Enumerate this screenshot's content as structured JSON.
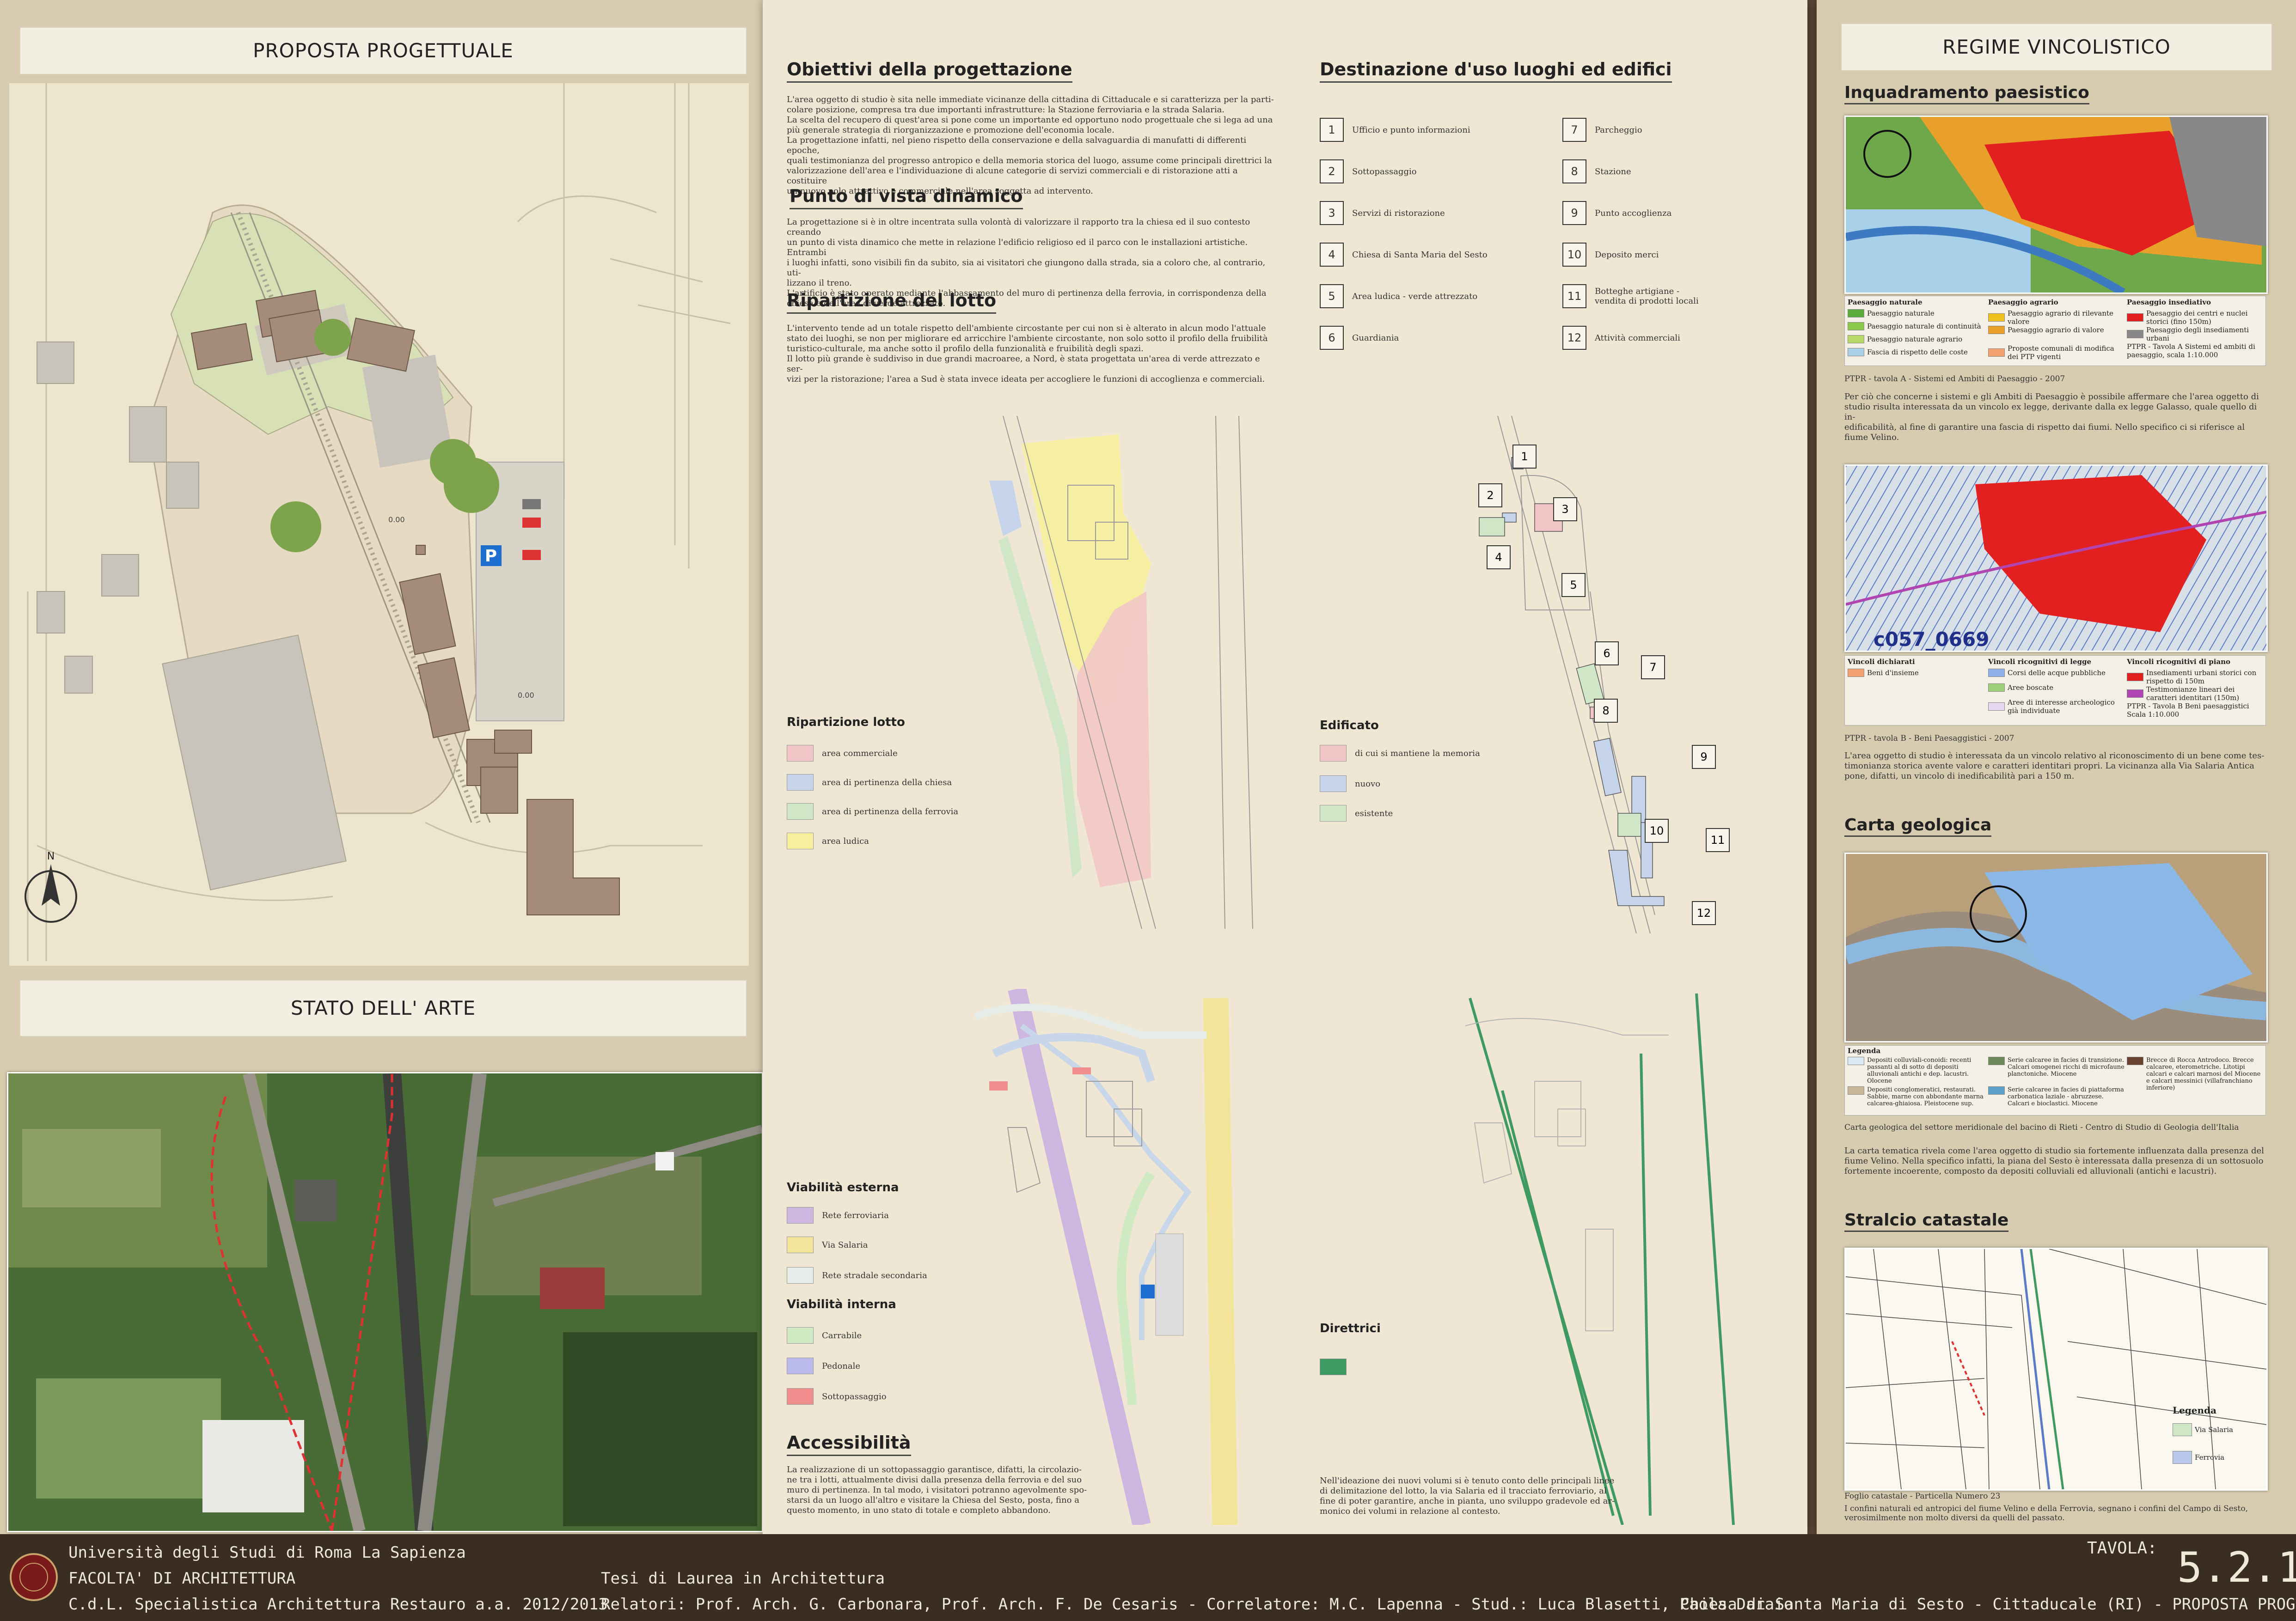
{
  "left": {
    "proposal_title": "PROPOSTA PROGETTUALE",
    "state_title": "STATO DELL' ARTE",
    "parking_icon": "P",
    "north": "N",
    "elev_a": "0.00",
    "elev_b": "0.00"
  },
  "mid": {
    "obj_heading": "Obiettivi della progettazione",
    "obj_text": "L'area oggetto di studio è sita nelle immediate vicinanze della cittadina di Cittaducale e si caratterizza per la parti-\ncolare posizione, compresa tra due importanti infrastrutture: la Stazione ferroviaria e la strada Salaria.\nLa scelta del recupero di quest'area si pone come un importante ed opportuno nodo progettuale che si lega ad una\npiù generale strategia di riorganizzazione e promozione dell'economia locale.\nLa progettazione infatti, nel pieno rispetto della conservazione e della salvaguardia di manufatti di differenti epoche,\nquali testimonianza del progresso antropico e della memoria storica del luogo, assume come principali direttrici la\nvalorizzazione dell'area e l'individuazione di alcune categorie di servizi commerciali e di ristorazione atti a costituire\nun nuovo polo attrattivo e commerciale nell'area soggetta ad intervento.",
    "view_heading": "Punto di vista dinamico",
    "view_text": "La progettazione si è in oltre incentrata sulla volontà di valorizzare il rapporto tra la chiesa ed il suo contesto creando\nun punto di vista dinamico che mette in relazione l'edificio religioso ed il parco con le installazioni artistiche. Entrambi\ni luoghi infatti, sono visibili fin da subito, sia ai visitatori che giungono dalla strada, sia a coloro che, al contrario, uti-\nlizzano il treno.\nL'artificio è stato operato mediante l'abbassamento del muro di pertinenza della ferrovia, in corrispondenza della\nchiesa e dell'area di verde attrezzato.",
    "lot_heading": "Ripartizione del lotto",
    "lot_text": "L'intervento tende ad un totale rispetto dell'ambiente circostante per cui non si è alterato in alcun modo l'attuale\nstato dei luoghi, se non per migliorare ed arricchire l'ambiente circostante, non solo sotto il profilo della fruibilità\nturistico-culturale, ma anche sotto il profilo della funzionalità e fruibilità degli spazi.\nIl lotto più grande è suddiviso in due grandi macroaree, a Nord, è stata progettata un'area di verde attrezzato e ser-\nvizi per la ristorazione; l'area a Sud è stata invece ideata per accogliere le funzioni di accoglienza e commerciali.",
    "dest_heading": "Destinazione d'uso luoghi ed edifici",
    "dest_items": [
      {
        "n": "1",
        "label": "Ufficio e punto informazioni"
      },
      {
        "n": "2",
        "label": "Sottopassaggio"
      },
      {
        "n": "3",
        "label": "Servizi di ristorazione"
      },
      {
        "n": "4",
        "label": "Chiesa di Santa Maria del Sesto"
      },
      {
        "n": "5",
        "label": "Area ludica - verde attrezzato"
      },
      {
        "n": "6",
        "label": "Guardiania"
      },
      {
        "n": "7",
        "label": "Parcheggio"
      },
      {
        "n": "8",
        "label": "Stazione"
      },
      {
        "n": "9",
        "label": "Punto accoglienza"
      },
      {
        "n": "10",
        "label": "Deposito merci"
      },
      {
        "n": "11",
        "label": "Botteghe artigiane - vendita di prodotti locali"
      },
      {
        "n": "12",
        "label": "Attività commerciali"
      }
    ],
    "rip_title": "Ripartizione lotto",
    "rip_items": [
      "area commerciale",
      "area di pertinenza della chiesa",
      "area di pertinenza della ferrovia",
      "area ludica"
    ],
    "edif_title": "Edificato",
    "edif_items": [
      "di cui si mantiene la memoria",
      "nuovo",
      "esistente"
    ],
    "viab_ext_title": "Viabilità esterna",
    "viab_ext_items": [
      "Rete ferroviaria",
      "Via Salaria",
      "Rete stradale secondaria"
    ],
    "viab_int_title": "Viabilità interna",
    "viab_int_items": [
      "Carrabile",
      "Pedonale",
      "Sottopassaggio"
    ],
    "dir_title": "Direttrici",
    "access_heading": "Accessibilità",
    "access_text": "La realizzazione di un sottopassaggio garantisce, difatti, la circolazio-\nne tra i lotti, attualmente divisi dalla presenza della ferrovia e del suo\nmuro di pertinenza. In tal modo, i visitatori potranno agevolmente spo-\nstarsi da un luogo all'altro e visitare la Chiesa del Sesto, posta, fino a\nquesto momento, in uno stato di totale e completo abbandono.",
    "dir_text": "Nell'ideazione dei nuovi volumi si è tenuto conto delle principali linee\ndi delimitazione del lotto, la via Salaria ed il tracciato ferroviario, al\nfine di poter garantire, anche in pianta, uno sviluppo gradevole ed ar-\nmonico dei volumi in relazione al contesto."
  },
  "right": {
    "title": "REGIME VINCOLISTICO",
    "paes_heading": "Inquadramento paesistico",
    "paes_legend": {
      "h1": "Paesaggio naturale",
      "h2": "Paesaggio agrario",
      "h3": "Paesaggio insediativo",
      "c1": [
        "Paesaggio naturale",
        "Paesaggio naturale di continuità",
        "Paesaggio naturale agrario",
        "Fascia di rispetto delle coste"
      ],
      "c2": [
        "Paesaggio agrario di rilevante valore",
        "Paesaggio agrario di valore",
        "Proposte comunali di modifica dei PTP vigenti"
      ],
      "c3": [
        "Paesaggio dei centri e nuclei storici (fino 150m)",
        "Paesaggio degli insediamenti urbani",
        "PTPR - Tavola A Sistemi ed ambiti di paesaggio, scala 1:10.000"
      ]
    },
    "paes_caption": "PTPR - tavola A - Sistemi ed Ambiti di Paesaggio - 2007",
    "paes_text": "Per ciò che concerne i sistemi e gli Ambiti di Paesaggio è possibile affermare che l'area oggetto di\nstudio risulta interessata da un vincolo ex legge, derivante dalla ex legge Galasso, quale quello di in-\nedificabilità, al fine di garantire una fascia di rispetto dai fiumi. Nello specifico ci si riferisce al\nfiume Velino.",
    "map2_code": "c057_0669",
    "vinc_legend": {
      "h1": "Vincoli dichiarati",
      "h2": "Vincoli ricognitivi di legge",
      "h3": "Vincoli ricognitivi di piano",
      "c1": [
        "Beni d'insieme"
      ],
      "c2": [
        "Corsi delle acque pubbliche",
        "Aree boscate",
        "Aree di interesse archeologico già individuate"
      ],
      "c3": [
        "Insediamenti urbani storici con rispetto di 150m",
        "Testimonianze lineari dei caratteri identitari (150m)",
        "PTPR - Tavola B Beni paesaggistici Scala 1:10.000"
      ]
    },
    "vinc_caption": "PTPR - tavola B - Beni Paesaggistici - 2007",
    "vinc_text": "L'area oggetto di studio è interessata da un vincolo relativo al riconoscimento di un bene come tes-\ntimonianza storica avente valore e caratteri identitari propri. La vicinanza alla Via Salaria Antica\npone, difatti, un vincolo di inedificabilità pari a 150 m.",
    "geo_heading": "Carta geologica",
    "geo_legend_title": "Legenda",
    "geo_legend": [
      "Depositi colluviali-conoidi: recenti passanti al di sotto di depositi alluvionali antichi e dep. lacustri. Olocene",
      "Depositi conglomeratici, restaurati. Sabbie, marne con abbondante marna calcarea-ghiaiosa. Pleistocene sup.",
      "Serie calcaree in facies di transizione. Calcari omogenei ricchi di microfaune planctoniche. Miocene",
      "Serie calcaree in facies di piattaforma carbonatica laziale - abruzzese. Calcari e bioclastici. Miocene",
      "Brecce di Rocca Antrodoco. Brecce calcaree, eterometriche. Litotipi calcari e calcari marnosi del Miocene e calcari messinici (villafranchiano inferiore)"
    ],
    "geo_caption": "Carta geologica del settore meridionale del bacino di Rieti - Centro di Studio di Geologia dell'Italia",
    "geo_text": "La carta tematica rivela come l'area oggetto di studio sia fortemente influenzata dalla presenza del\nfiume Velino. Nella specifico infatti, la piana del Sesto è interessata dalla presenza di un sottosuolo\nfortemente incoerente, composto da depositi colluviali ed alluvionali (antichi e lacustri).",
    "cat_heading": "Stralcio catastale",
    "cat_legend_title": "Legenda",
    "cat_legend": [
      "Via Salaria",
      "Ferrovia"
    ],
    "cat_caption": "Foglio catastale - Particella Numero 23",
    "cat_text": "I confini naturali ed antropici del fiume Velino e della Ferrovia, segnano i confini del Campo di Sesto,\nverosimilmente non molto diversi da quelli del passato."
  },
  "footer": {
    "university": "Università degli Studi di Roma La Sapienza",
    "faculty": "FACOLTA' DI ARCHITETTURA",
    "course": "C.d.L. Specialistica Architettura Restauro a.a. 2012/2013",
    "thesis": "Tesi  di Laurea  in Architettura",
    "credits": "Relatori: Prof. Arch. G. Carbonara, Prof. Arch. F. De Cesaris - Correlatore: M.C. Lapenna - Stud.: Luca Blasetti, Paola Daraio",
    "tavola_label": "TAVOLA:",
    "tavola_num": "5.2.1",
    "project": "Chiesa di Santa Maria di Sesto - Cittaducale (RI) - PROPOSTA PROGETTUALE"
  },
  "colors": {
    "commerciale": "#f2c6c6",
    "chiesa": "#c5d4ea",
    "ferrovia": "#cfe7c6",
    "ludica": "#f6ef9c",
    "ferroviaria": "#cdb6e0",
    "salaria": "#f2e59a",
    "secondaria": "#e6ece8",
    "carrabile": "#cfe9c2",
    "pedonale": "#b9b9ea",
    "sottopassaggio": "#f08e8e",
    "direttrici": "#3f9a62"
  }
}
